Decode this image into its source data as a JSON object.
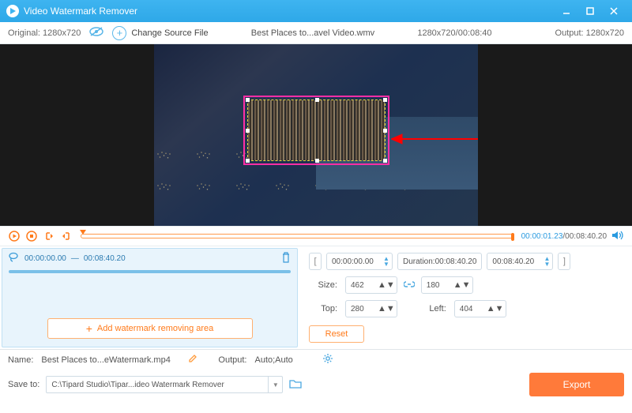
{
  "titlebar": {
    "title": "Video Watermark Remover"
  },
  "toolbar": {
    "original_label": "Original:",
    "original_res": "1280x720",
    "change_source": "Change Source File",
    "filename": "Best Places to...avel Video.wmv",
    "res_time": "1280x720/00:08:40",
    "output_label": "Output:",
    "output_res": "1280x720"
  },
  "playback": {
    "current": "00:00:01.23",
    "total": "00:08:40.20"
  },
  "segment": {
    "start": "00:00:00.00",
    "end": "00:08:40.20"
  },
  "add_area_label": "Add watermark removing area",
  "range": {
    "start": "00:00:00.00",
    "duration_label": "Duration:",
    "duration": "00:08:40.20",
    "end": "00:08:40.20"
  },
  "size": {
    "label": "Size:",
    "w": "462",
    "h": "180"
  },
  "pos": {
    "top_label": "Top:",
    "top": "280",
    "left_label": "Left:",
    "left": "404"
  },
  "reset_label": "Reset",
  "footer": {
    "name_label": "Name:",
    "name_value": "Best Places to...eWatermark.mp4",
    "output_label": "Output:",
    "output_value": "Auto;Auto",
    "save_label": "Save to:",
    "save_path": "C:\\Tipard Studio\\Tipar...ideo Watermark Remover",
    "export": "Export"
  }
}
